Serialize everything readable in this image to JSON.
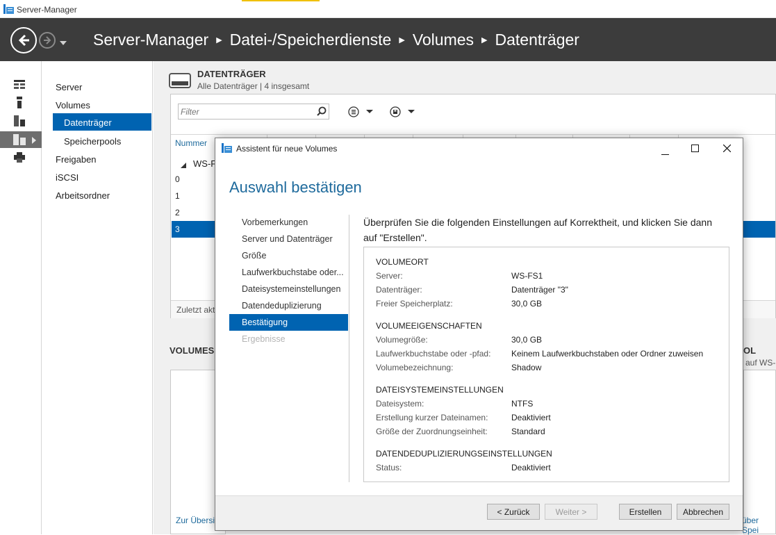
{
  "window": {
    "title": "Server-Manager"
  },
  "breadcrumb": [
    "Server-Manager",
    "Datei-/Speicherdienste",
    "Volumes",
    "Datenträger"
  ],
  "nav": {
    "items": [
      "Server",
      "Volumes",
      "Datenträger",
      "Speicherpools",
      "Freigaben",
      "iSCSI",
      "Arbeitsordner"
    ],
    "selected": "Datenträger"
  },
  "disks": {
    "title": "DATENTRÄGER",
    "subtitle": "Alle Datenträger | 4 insgesamt",
    "filter_placeholder": "Filter",
    "column_number": "Nummer",
    "group_label": "WS-F",
    "rows": [
      "0",
      "1",
      "2",
      "3"
    ],
    "footer": "Zuletzt akt"
  },
  "volumes": {
    "title": "VOLUMES",
    "link": "Zur Übersic"
  },
  "right_fragments": {
    "title": "OL",
    "subtitle": "auf WS-",
    "link": "über Spei"
  },
  "dialog": {
    "title": "Assistent für neue Volumes",
    "heading": "Auswahl bestätigen",
    "steps": [
      "Vorbemerkungen",
      "Server und Datenträger",
      "Größe",
      "Laufwerkbuchstabe oder...",
      "Dateisystemeinstellungen",
      "Datendeduplizierung",
      "Bestätigung",
      "Ergebnisse"
    ],
    "active_step": "Bestätigung",
    "instruction": "Überprüfen Sie die folgenden Einstellungen auf Korrektheit, und klicken Sie dann auf \"Erstellen\".",
    "sections": [
      {
        "title": "VOLUMEORT",
        "rows": [
          {
            "label": "Server:",
            "value": "WS-FS1"
          },
          {
            "label": "Datenträger:",
            "value": "Datenträger \"3\""
          },
          {
            "label": "Freier Speicherplatz:",
            "value": "30,0 GB"
          }
        ]
      },
      {
        "title": "VOLUMEEIGENSCHAFTEN",
        "rows": [
          {
            "label": "Volumegröße:",
            "value": "30,0 GB"
          },
          {
            "label": "Laufwerkbuchstabe oder -pfad:",
            "value": "Keinem Laufwerkbuchstaben oder Ordner zuweisen"
          },
          {
            "label": "Volumebezeichnung:",
            "value": "Shadow"
          }
        ]
      },
      {
        "title": "DATEISYSTEMEINSTELLUNGEN",
        "rows": [
          {
            "label": "Dateisystem:",
            "value": "NTFS"
          },
          {
            "label": "Erstellung kurzer Dateinamen:",
            "value": "Deaktiviert"
          },
          {
            "label": "Größe der Zuordnungseinheit:",
            "value": "Standard"
          }
        ]
      },
      {
        "title": "DATENDEDUPLIZIERUNGSEINSTELLUNGEN",
        "rows": [
          {
            "label": "Status:",
            "value": "Deaktiviert"
          }
        ]
      }
    ],
    "buttons": {
      "back": "< Zurück",
      "next": "Weiter >",
      "create": "Erstellen",
      "cancel": "Abbrechen"
    }
  },
  "colors": {
    "header": "#3c3c3c",
    "accent": "#0063b1",
    "heading": "#1e6a9c"
  }
}
